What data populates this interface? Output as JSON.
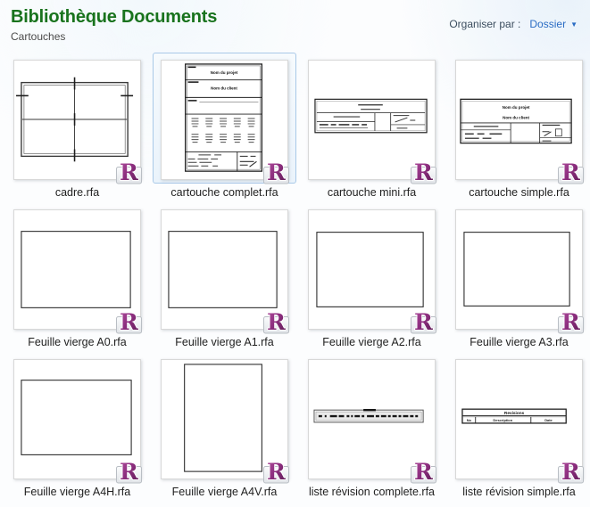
{
  "header": {
    "title": "Bibliothèque Documents",
    "subtitle": "Cartouches",
    "organize_label": "Organiser par :",
    "organize_value": "Dossier",
    "organize_arrow": "▼"
  },
  "colors": {
    "title_green": "#19731d",
    "link_blue": "#2a6cc4",
    "selection_border": "#a9c9e8",
    "selection_fill": "#f2f8fd",
    "revit_purple": "#8e2f80"
  },
  "thumb_texts": {
    "project": "Nom du projet",
    "client": "Nom du client",
    "revisions_title": "Revisions",
    "rev_col_no": "No",
    "rev_col_description": "Description",
    "rev_col_date": "Date"
  },
  "items": [
    {
      "name": "cadre.rfa",
      "selected": false
    },
    {
      "name": "cartouche complet.rfa",
      "selected": true
    },
    {
      "name": "cartouche mini.rfa",
      "selected": false
    },
    {
      "name": "cartouche simple.rfa",
      "selected": false
    },
    {
      "name": "Feuille vierge A0.rfa",
      "selected": false
    },
    {
      "name": "Feuille vierge A1.rfa",
      "selected": false
    },
    {
      "name": "Feuille vierge A2.rfa",
      "selected": false
    },
    {
      "name": "Feuille vierge A3.rfa",
      "selected": false
    },
    {
      "name": "Feuille vierge A4H.rfa",
      "selected": false
    },
    {
      "name": "Feuille vierge A4V.rfa",
      "selected": false
    },
    {
      "name": "liste révision complete.rfa",
      "selected": false
    },
    {
      "name": "liste révision simple.rfa",
      "selected": false
    }
  ]
}
